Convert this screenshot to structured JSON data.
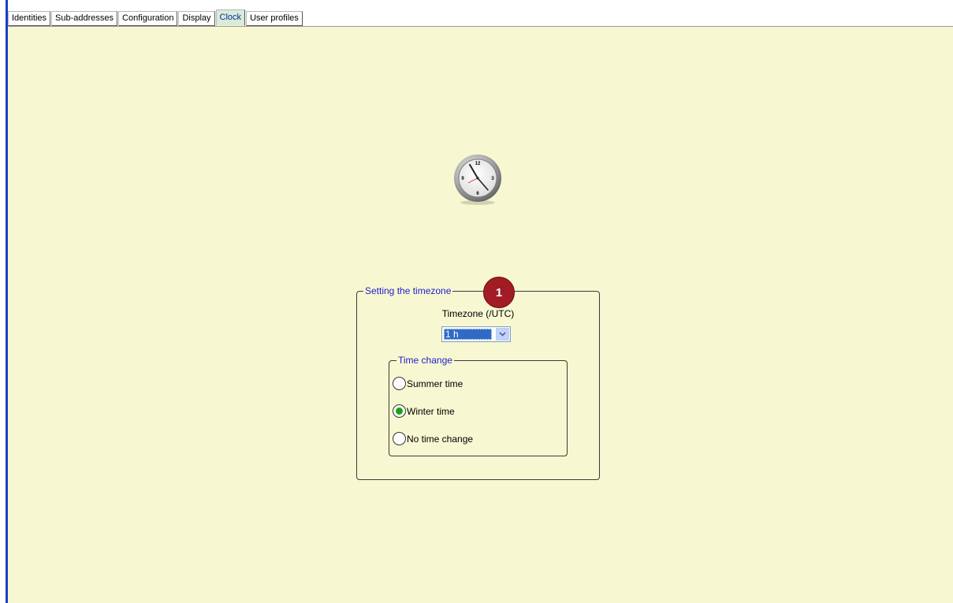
{
  "tabs": [
    {
      "label": "Identities",
      "active": false
    },
    {
      "label": "Sub-addresses",
      "active": false
    },
    {
      "label": "Configuration",
      "active": false
    },
    {
      "label": "Display",
      "active": false
    },
    {
      "label": "Clock",
      "active": true
    },
    {
      "label": "User profiles",
      "active": false
    }
  ],
  "clock": {
    "icon": "clock-icon",
    "numerals": [
      "12",
      "3",
      "6",
      "9"
    ]
  },
  "timezone_group": {
    "legend": "Setting the timezone",
    "badge": "1",
    "badge_color": "#a11c24",
    "field_label": "Timezone (/UTC)",
    "selected_value": "1 h"
  },
  "time_change_group": {
    "legend": "Time change",
    "options": [
      {
        "label": "Summer time",
        "checked": false
      },
      {
        "label": "Winter time",
        "checked": true
      },
      {
        "label": "No time change",
        "checked": false
      }
    ]
  },
  "colors": {
    "panel_background": "#f7f7d2",
    "legend_text": "#2020cc",
    "radio_checked": "#1aa21a",
    "selection": "#316ac5"
  }
}
